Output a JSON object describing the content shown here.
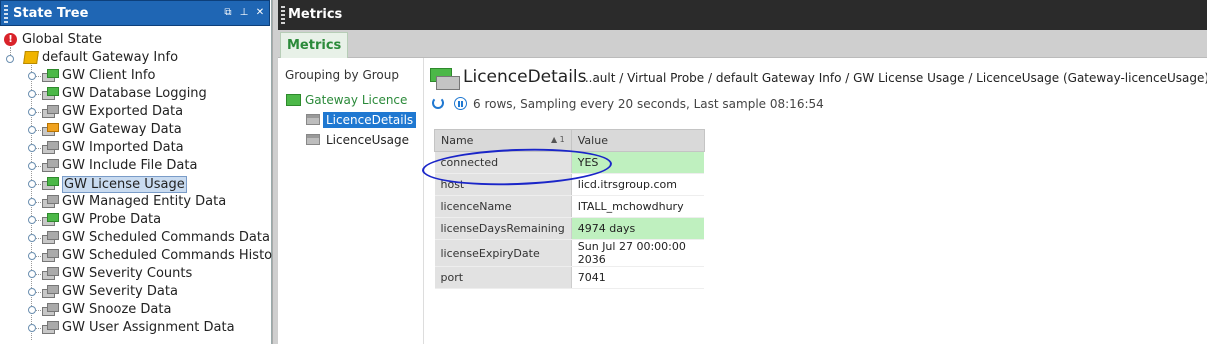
{
  "left_panel": {
    "title": "State Tree",
    "root": "Global State",
    "gateway": "default Gateway Info",
    "items": [
      {
        "label": "GW Client Info",
        "color": "green"
      },
      {
        "label": "GW Database Logging",
        "color": "green"
      },
      {
        "label": "GW Exported Data",
        "color": "gray"
      },
      {
        "label": "GW Gateway Data",
        "color": "orange"
      },
      {
        "label": "GW Imported Data",
        "color": "gray"
      },
      {
        "label": "GW Include File Data",
        "color": "gray"
      },
      {
        "label": "GW License Usage",
        "color": "green",
        "selected": true
      },
      {
        "label": "GW Managed Entity Data",
        "color": "gray"
      },
      {
        "label": "GW Probe Data",
        "color": "green"
      },
      {
        "label": "GW Scheduled Commands Data",
        "color": "gray"
      },
      {
        "label": "GW Scheduled Commands History Da",
        "color": "gray"
      },
      {
        "label": "GW Severity Counts",
        "color": "gray"
      },
      {
        "label": "GW Severity Data",
        "color": "gray"
      },
      {
        "label": "GW Snooze Data",
        "color": "gray"
      },
      {
        "label": "GW User Assignment Data",
        "color": "gray"
      }
    ]
  },
  "right_panel": {
    "title": "Metrics",
    "tab": "Metrics",
    "grouping_title": "Grouping by Group",
    "group_name": "Gateway Licence",
    "group_items": [
      "LicenceDetails",
      "LicenceUsage"
    ],
    "detail_title": "LicenceDetails",
    "detail_path": "...ault / Virtual Probe / default Gateway Info / GW License Usage / LicenceUsage (Gateway-licenceUsage)",
    "status": "6 rows, Sampling every 20 seconds, Last sample 08:16:54",
    "table": {
      "headers": [
        "Name",
        "Value"
      ],
      "sort_indicator": "▲ 1",
      "rows": [
        {
          "name": "connected",
          "value": "YES",
          "highlight": true
        },
        {
          "name": "host",
          "value": "licd.itrsgroup.com",
          "highlight": false
        },
        {
          "name": "licenceName",
          "value": "ITALL_mchowdhury",
          "highlight": false
        },
        {
          "name": "licenseDaysRemaining",
          "value": "4974 days",
          "highlight": true
        },
        {
          "name": "licenseExpiryDate",
          "value": "Sun Jul 27 00:00:00 2036",
          "highlight": false
        },
        {
          "name": "port",
          "value": "7041",
          "highlight": false
        }
      ]
    }
  },
  "colors": {
    "accent_blue": "#1f66b4",
    "ok_green": "#bff0bf",
    "annotation": "#1a25c8"
  }
}
